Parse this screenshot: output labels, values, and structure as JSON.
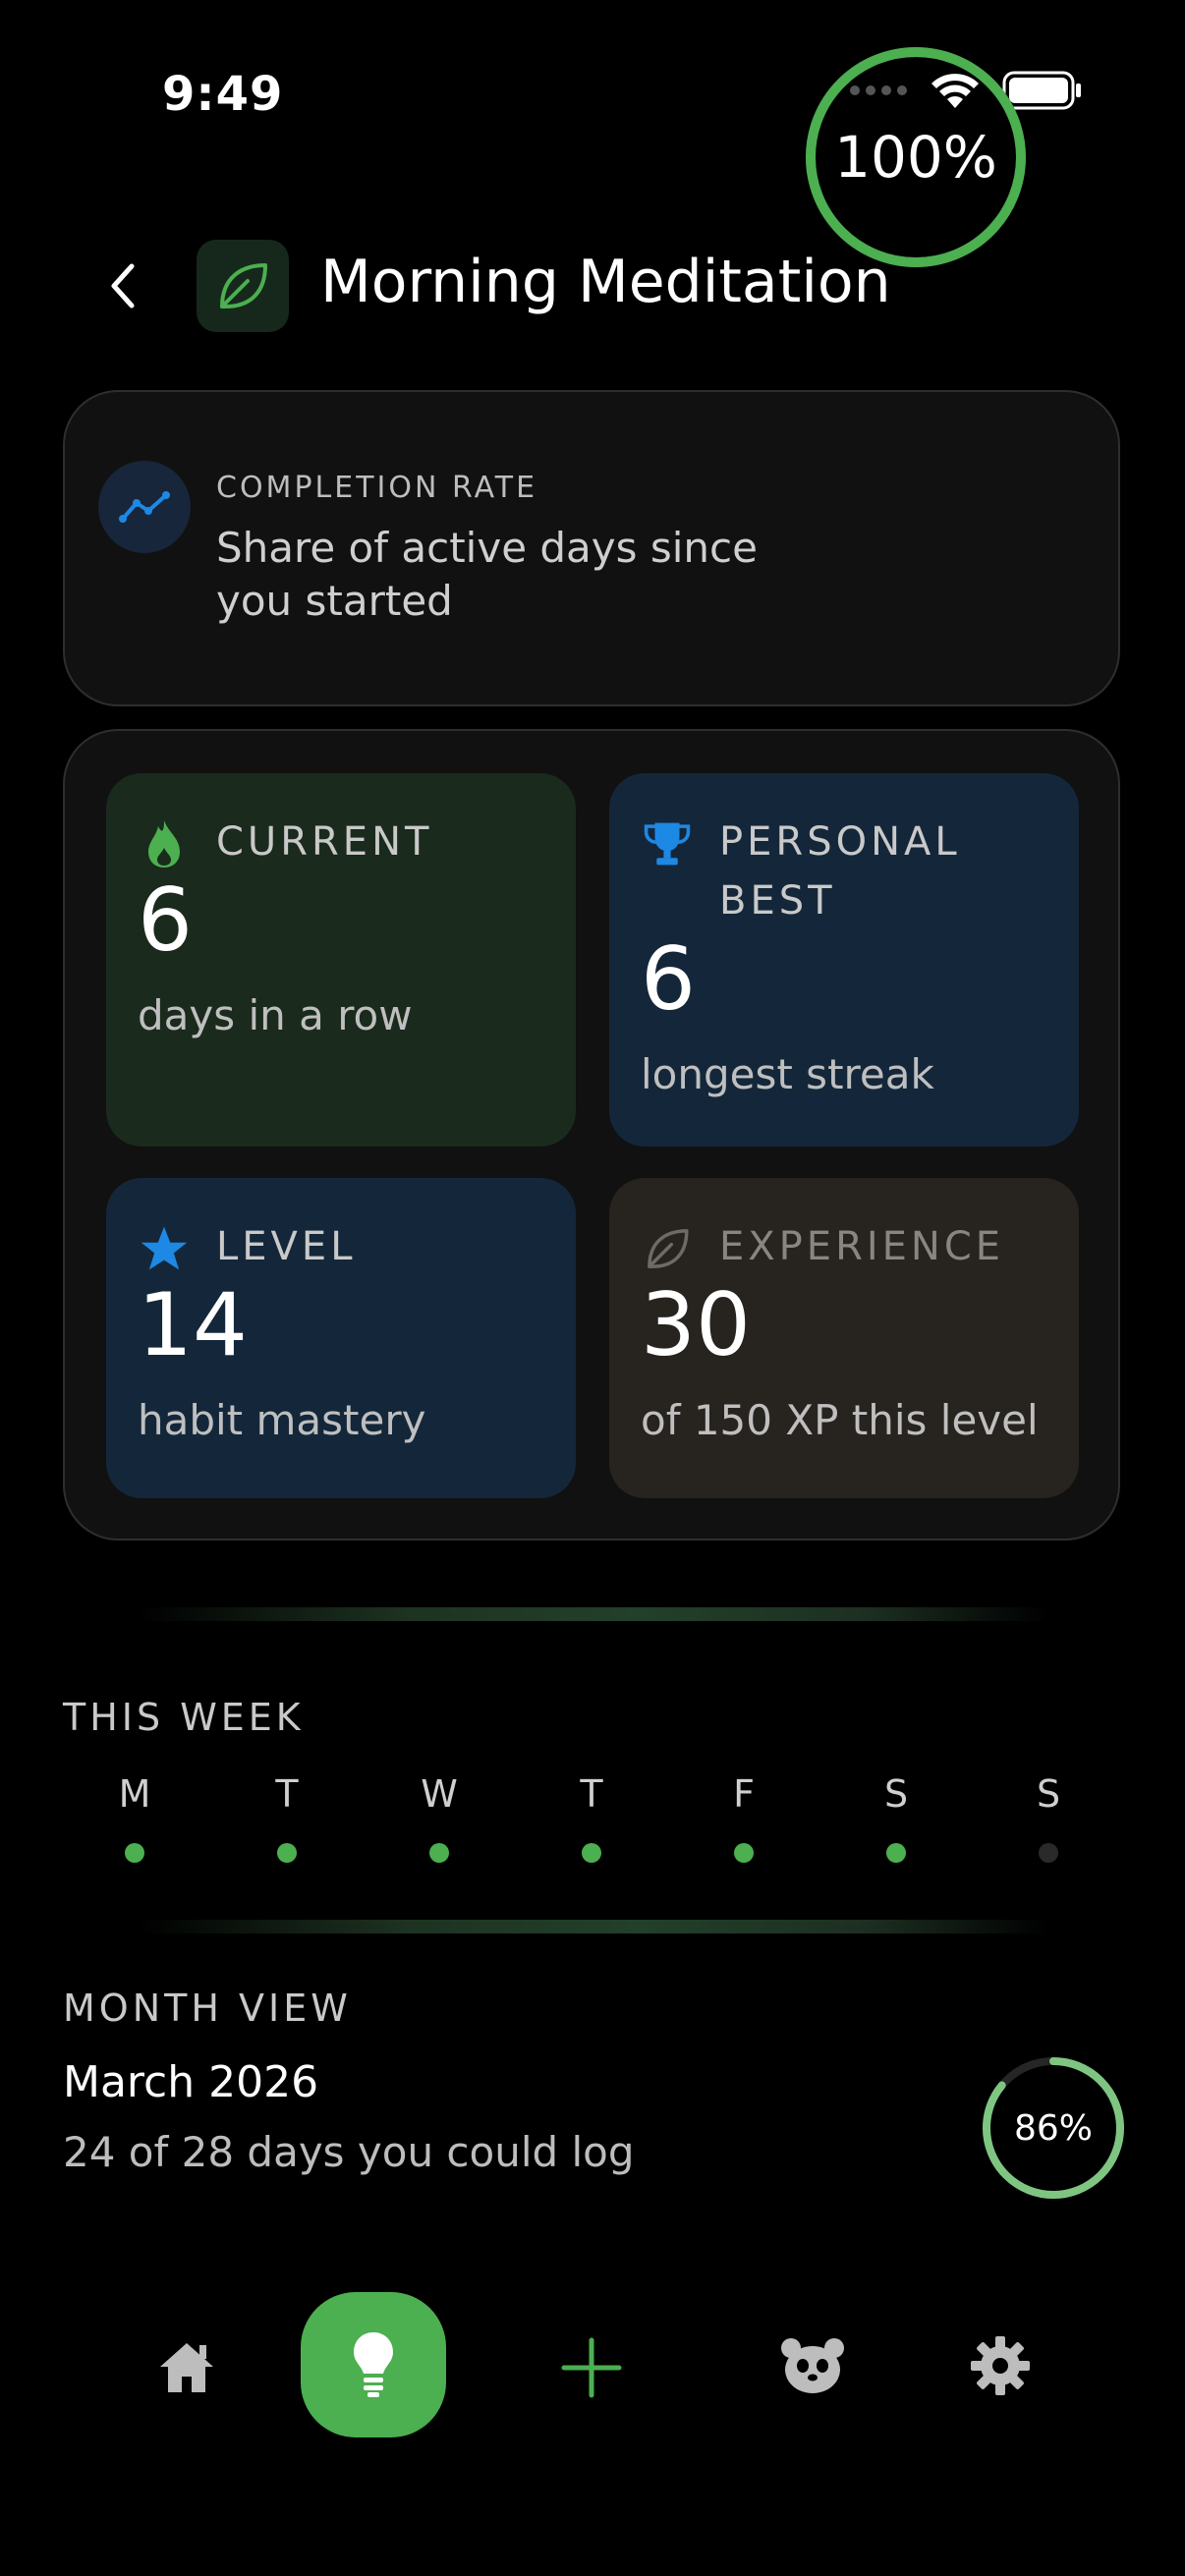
{
  "status": {
    "time": "9:49"
  },
  "header": {
    "title": "Morning Meditation"
  },
  "completion": {
    "label": "COMPLETION RATE",
    "description": "Share of active days since you started",
    "value_text": "100%",
    "fraction": 1.0
  },
  "stats": {
    "current": {
      "label": "CURRENT",
      "value": "6",
      "sub": "days in a row"
    },
    "best": {
      "label": "PERSONAL BEST",
      "value": "6",
      "sub": "longest streak"
    },
    "level": {
      "label": "LEVEL",
      "value": "14",
      "sub": "habit mastery"
    },
    "experience": {
      "label": "EXPERIENCE",
      "value": "30",
      "sub": "of 150 XP this level"
    }
  },
  "week": {
    "label": "THIS WEEK",
    "days": [
      {
        "letter": "M",
        "done": true
      },
      {
        "letter": "T",
        "done": true
      },
      {
        "letter": "W",
        "done": true
      },
      {
        "letter": "T",
        "done": true
      },
      {
        "letter": "F",
        "done": true
      },
      {
        "letter": "S",
        "done": true
      },
      {
        "letter": "S",
        "done": false
      }
    ]
  },
  "month": {
    "label": "MONTH VIEW",
    "title": "March 2026",
    "sub": "24 of 28 days you could log",
    "value_text": "86%",
    "fraction": 0.86
  },
  "colors": {
    "accent_green": "#4caf50",
    "accent_blue": "#1e88e5",
    "dot_inactive": "#2a2a2a"
  },
  "nav": {
    "items": [
      "home-icon",
      "lightbulb-icon",
      "plus-icon",
      "panda-icon",
      "gear-icon"
    ],
    "active": "lightbulb-icon"
  }
}
